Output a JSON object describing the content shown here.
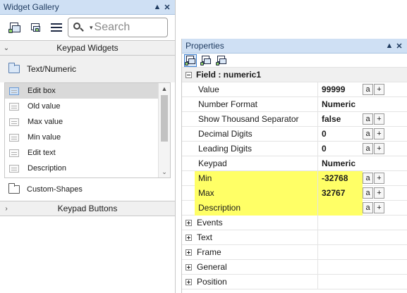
{
  "widget_gallery": {
    "title": "Widget Gallery",
    "search_placeholder": "Search",
    "keypad_widgets_label": "Keypad Widgets",
    "text_numeric_label": "Text/Numeric",
    "items": [
      "Edit box",
      "Old value",
      "Max value",
      "Min value",
      "Edit text",
      "Description"
    ],
    "custom_shapes_label": "Custom-Shapes",
    "keypad_buttons_label": "Keypad Buttons"
  },
  "properties": {
    "title": "Properties",
    "field_header": "Field : numeric1",
    "rows": [
      {
        "name": "Value",
        "value": "99999",
        "buttons": [
          "a",
          "+"
        ],
        "highlight": false
      },
      {
        "name": "Number Format",
        "value": "Numeric",
        "buttons": [],
        "highlight": false
      },
      {
        "name": "Show Thousand Separator",
        "value": "false",
        "buttons": [
          "a",
          "+"
        ],
        "highlight": false
      },
      {
        "name": "Decimal Digits",
        "value": "0",
        "buttons": [
          "a",
          "+"
        ],
        "highlight": false
      },
      {
        "name": "Leading Digits",
        "value": "0",
        "buttons": [
          "a",
          "+"
        ],
        "highlight": false
      },
      {
        "name": "Keypad",
        "value": "Numeric",
        "buttons": [],
        "highlight": false
      },
      {
        "name": "Min",
        "value": "-32768",
        "buttons": [
          "a",
          "+"
        ],
        "highlight": true
      },
      {
        "name": "Max",
        "value": "32767",
        "buttons": [
          "a",
          "+"
        ],
        "highlight": true
      },
      {
        "name": "Description",
        "value": "",
        "buttons": [
          "a",
          "+"
        ],
        "highlight": true
      }
    ],
    "categories": [
      "Events",
      "Text",
      "Frame",
      "General",
      "Position"
    ]
  },
  "colors": {
    "highlight": "#ffff66",
    "title_bar": "#cfe0f4",
    "selected_item": "#d9d9d9"
  }
}
